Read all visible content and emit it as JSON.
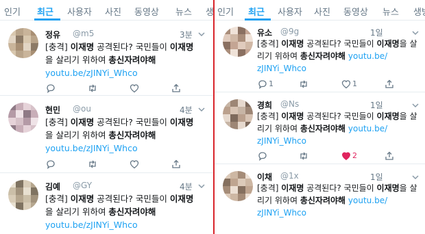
{
  "left": {
    "tabs": [
      {
        "label": "인기",
        "active": false
      },
      {
        "label": "최근",
        "active": true
      },
      {
        "label": "사용자",
        "active": false
      },
      {
        "label": "사진",
        "active": false
      },
      {
        "label": "동영상",
        "active": false
      },
      {
        "label": "뉴스",
        "active": false
      },
      {
        "label": "생",
        "active": false
      }
    ],
    "tweets": [
      {
        "name": "정유",
        "handle": "@m5",
        "time": "3분",
        "line1_a": "[충격] ",
        "line1_b": "이재명",
        "line1_c": " 공격된다? 국민들이 ",
        "line1_d": "이재명",
        "line2_a": "을 살리기 위하여 ",
        "line2_b": "총신자려야해",
        "link": "youtu.be/zJINYi_Whco",
        "reply_count": "",
        "like_count": ""
      },
      {
        "name": "현민",
        "handle": "@ou",
        "time": "4분",
        "line1_a": "[충격] ",
        "line1_b": "이재명",
        "line1_c": " 공격된다? 국민들이 ",
        "line1_d": "이재명",
        "line2_a": "을 살리기 위하여 ",
        "line2_b": "총신자려야해",
        "link": "youtu.be/zJINYi_Whco",
        "reply_count": "",
        "like_count": ""
      },
      {
        "name": "김예",
        "handle": "@GY",
        "time": "4분",
        "line1_a": "[충격] ",
        "line1_b": "이재명",
        "line1_c": " 공격된다? 국민들이 ",
        "line1_d": "이재명",
        "line2_a": "을 살리기 위하여 ",
        "line2_b": "총신자려야해",
        "link": "youtu.be/zJINYi_Whco",
        "reply_count": "",
        "like_count": ""
      }
    ]
  },
  "right": {
    "tabs": [
      {
        "label": "인기",
        "active": false
      },
      {
        "label": "최근",
        "active": true
      },
      {
        "label": "사용자",
        "active": false
      },
      {
        "label": "사진",
        "active": false
      },
      {
        "label": "동영상",
        "active": false
      },
      {
        "label": "뉴스",
        "active": false
      },
      {
        "label": "생방",
        "active": false
      }
    ],
    "tweets": [
      {
        "name": "유소",
        "handle": "@9g",
        "time": "1일",
        "line1_a": "[충격] ",
        "line1_b": "이재명",
        "line1_c": " 공격된다? 국민들이 ",
        "line1_d": "이재명",
        "line1_e": "을 살",
        "line2_a": "리기 위하여 ",
        "line2_b": "총신자려야해",
        "line2_c": " youtu.be/",
        "line3": "zJINYi_Whco",
        "reply_count": "1",
        "like_count": "1"
      },
      {
        "name": "경희",
        "handle": "@Ns",
        "time": "1일",
        "line1_a": "[충격] ",
        "line1_b": "이재명",
        "line1_c": " 공격된다? 국민들이 ",
        "line1_d": "이재명",
        "line1_e": "을 살",
        "line2_a": "리기 위하여 ",
        "line2_b": "총신자려야해",
        "line2_c": " youtu.be/",
        "line3": "zJINYi_Whco",
        "reply_count": "",
        "like_count": "2"
      },
      {
        "name": "이채",
        "handle": "@1x",
        "time": "1일",
        "line1_a": "[충격] ",
        "line1_b": "이재명",
        "line1_c": " 공격된다? 국민들이 ",
        "line1_d": "이재명",
        "line1_e": "을 살",
        "line2_a": "리기 위하여 ",
        "line2_b": "총신자려야해",
        "line2_c": " youtu.be/",
        "line3": "zJINYi_Whco",
        "reply_count": "",
        "like_count": ""
      }
    ]
  },
  "colors": {
    "accent": "#1da1f2",
    "divider": "#d8232a",
    "like_active": "#e0245e"
  },
  "icons": [
    "reply-icon",
    "retweet-icon",
    "like-icon",
    "share-icon",
    "chevron-down-icon"
  ]
}
